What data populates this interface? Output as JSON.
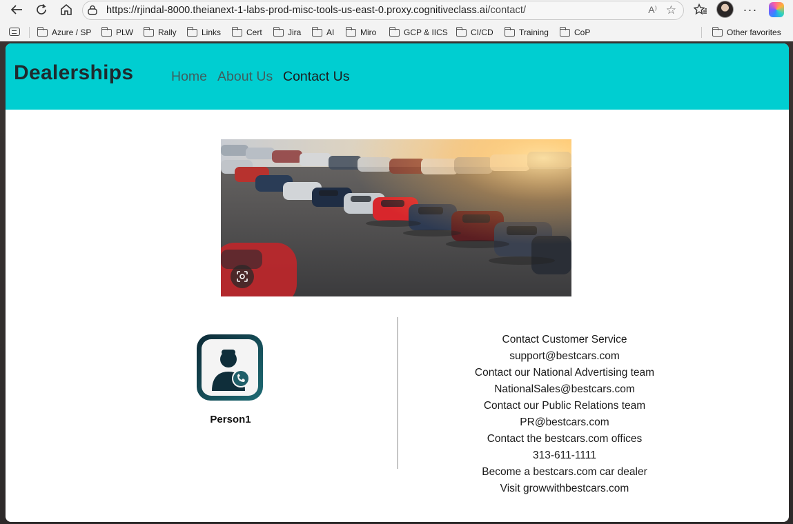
{
  "browser": {
    "url_main": "https://rjindal-8000.theianext-1-labs-prod-misc-tools-us-east-0.proxy.cognitiveclass.ai",
    "url_path": "/contact/",
    "read_aloud_label": "A⁾",
    "bookmarks": [
      "Azure / SP",
      "PLW",
      "Rally",
      "Links",
      "Cert",
      "Jira",
      "AI",
      "Miro",
      "GCP & IICS",
      "CI/CD",
      "Training",
      "CoP"
    ],
    "other_favorites": "Other favorites"
  },
  "navbar": {
    "brand": "Dealerships",
    "links": [
      "Home",
      "About Us",
      "Contact Us"
    ],
    "active_index": 2,
    "background": "#00ced1"
  },
  "contact": {
    "person_name": "Person1",
    "lines": [
      "Contact Customer Service",
      "support@bestcars.com",
      "Contact our National Advertising team",
      "NationalSales@bestcars.com",
      "Contact our Public Relations team",
      "PR@bestcars.com",
      "Contact the bestcars.com offices",
      "313-611-1111",
      "Become a bestcars.com car dealer",
      "Visit growwithbestcars.com"
    ]
  },
  "icons": [
    "back-icon",
    "reload-icon",
    "home-icon",
    "lock-icon",
    "star-icon",
    "favorites-icon",
    "more-icon",
    "copilot-icon",
    "lens-icon",
    "folder-icon"
  ]
}
